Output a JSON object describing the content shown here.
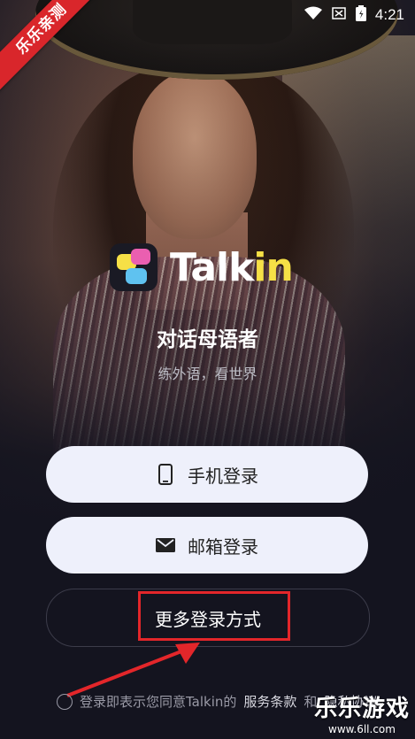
{
  "status": {
    "time": "4:21",
    "icons": [
      "wifi-icon",
      "signal-icon",
      "battery-icon"
    ]
  },
  "ribbon": {
    "text": "乐乐亲测"
  },
  "app": {
    "name_main": "Talk",
    "name_highlight": "in"
  },
  "tagline": "对话母语者",
  "subtagline": "练外语，看世界",
  "buttons": {
    "phone": "手机登录",
    "email": "邮箱登录",
    "more": "更多登录方式"
  },
  "agreement": {
    "prefix": "登录即表示您同意Talkin的",
    "terms": "服务条款",
    "and": "和",
    "privacy": "隐私协议"
  },
  "watermark": {
    "title": "乐乐游戏",
    "url": "www.6ll.com"
  },
  "colors": {
    "accent_yellow": "#f6e046",
    "highlight_red": "#e3262a",
    "button_bg": "#eef0fb"
  }
}
